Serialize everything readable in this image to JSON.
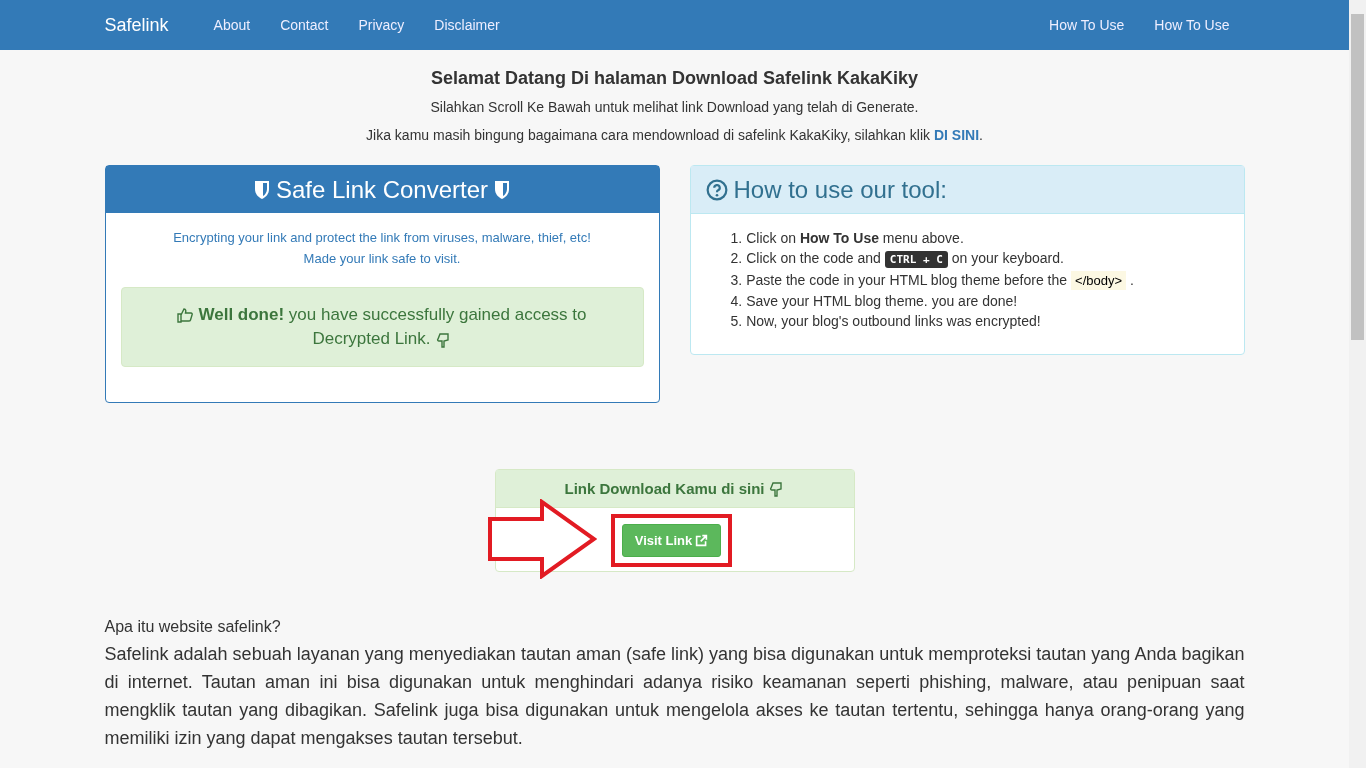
{
  "navbar": {
    "brand": "Safelink",
    "left_links": [
      "About",
      "Contact",
      "Privacy",
      "Disclaimer"
    ],
    "right_links": [
      "How To Use",
      "How To Use"
    ]
  },
  "intro": {
    "title": "Selamat Datang Di halaman Download Safelink KakaKiky",
    "line_1": "Silahkan Scroll Ke Bawah untuk melihat link Download yang telah di Generate.",
    "line_2": "Jika kamu masih bingung bagaimana cara mendownload di safelink KakaKiky, silahkan klik",
    "link": "DI SINI",
    "line_2_end": "."
  },
  "converter": {
    "title": "Safe Link Converter",
    "description": [
      "Encrypting your link and protect the link from viruses, malware, thief, etc!",
      "Made your link safe to visit."
    ],
    "alert": [
      "**Well done!** you have successfully gained access to",
      "Decrypted Link."
    ]
  },
  "how_to": {
    "title": "How to use our tool:",
    "steps": [
      {
        "marker": "1.",
        "parts": [
          {
            "kind": "text",
            "text": "Click on **How To Use** menu above."
          }
        ]
      },
      {
        "marker": "2.",
        "parts": [
          {
            "kind": "text",
            "text": "Click on the code and"
          },
          {
            "kind": "kbd",
            "text": "CTRL + C"
          },
          {
            "kind": "text",
            "text": "on your keyboard."
          }
        ]
      },
      {
        "marker": "3.",
        "parts": [
          {
            "kind": "text",
            "text": "Paste the code in your HTML blog theme before the"
          },
          {
            "kind": "code",
            "text": "</body>"
          },
          {
            "kind": "text",
            "text": "."
          }
        ]
      },
      {
        "marker": "4.",
        "parts": [
          {
            "kind": "text",
            "text": "Save your HTML blog theme. you are done!"
          }
        ]
      },
      {
        "marker": "5.",
        "parts": [
          {
            "kind": "text",
            "text": "Now, your blog's outbound links was encrypted!"
          }
        ]
      }
    ]
  },
  "download": {
    "title": "Link Download Kamu di sini",
    "button": "Visit Link"
  },
  "article": {
    "heading": "Apa itu website safelink?",
    "body": "Safelink adalah sebuah layanan yang menyediakan tautan aman (safe link) yang bisa digunakan untuk memproteksi tautan yang Anda bagikan di internet. Tautan aman ini bisa digunakan untuk menghindari adanya risiko keamanan seperti phishing, malware, atau penipuan saat mengklik tautan yang dibagikan. Safelink juga bisa digunakan untuk mengelola akses ke tautan tertentu, sehingga hanya orang-orang yang memiliki izin yang dapat mengakses tautan tersebut."
  }
}
